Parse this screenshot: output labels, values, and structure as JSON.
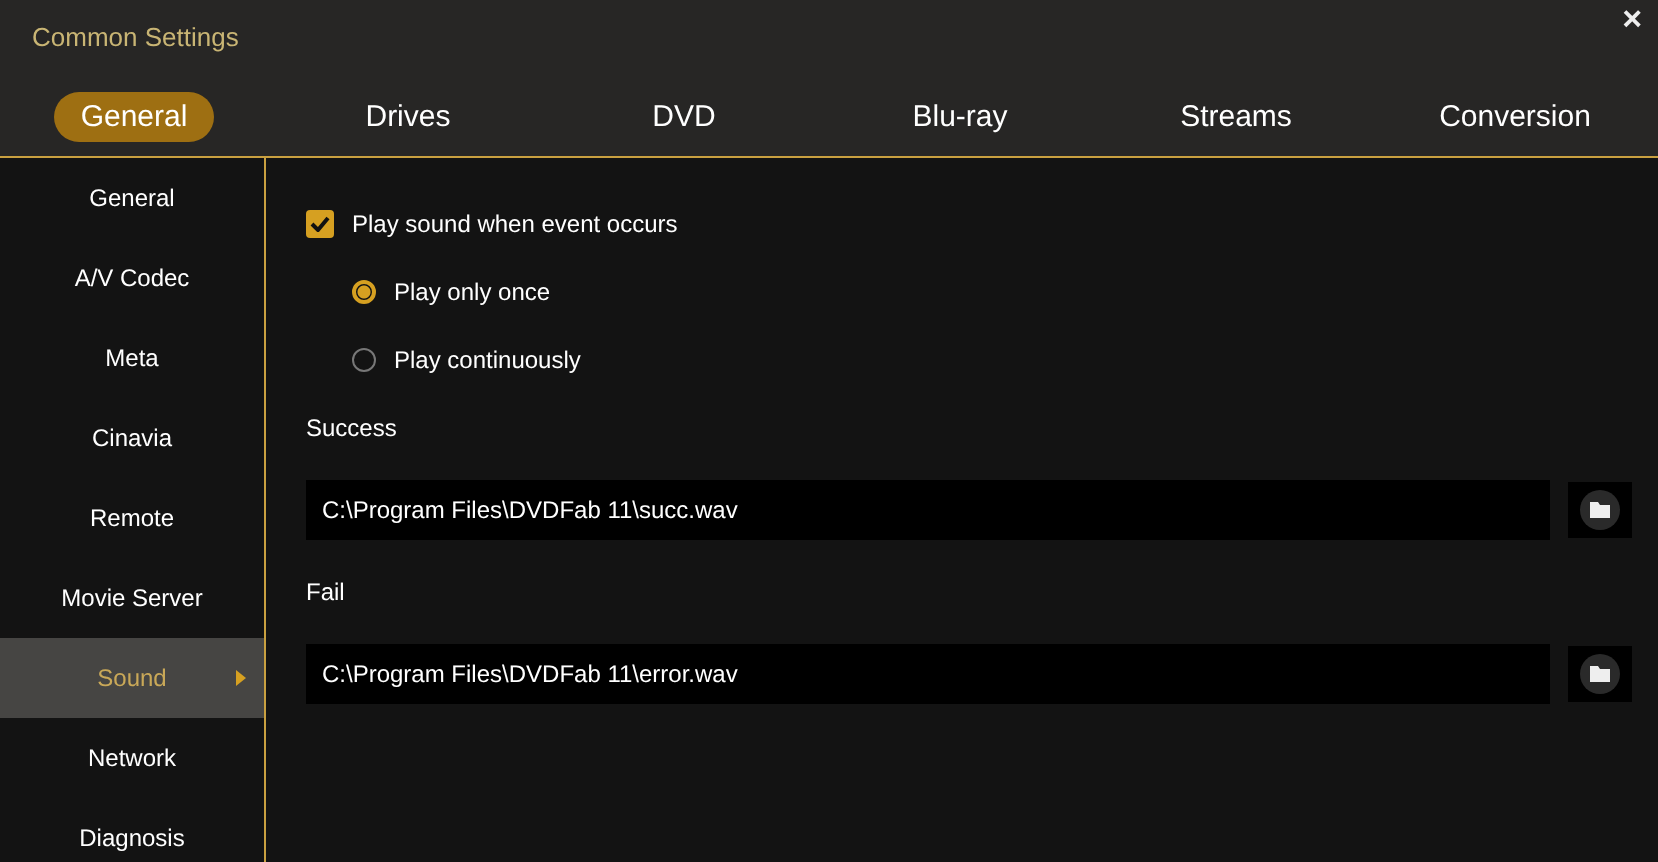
{
  "window": {
    "title": "Common Settings",
    "close": "×"
  },
  "tabs": [
    {
      "label": "General",
      "selected": true
    },
    {
      "label": "Drives",
      "selected": false
    },
    {
      "label": "DVD",
      "selected": false
    },
    {
      "label": "Blu-ray",
      "selected": false
    },
    {
      "label": "Streams",
      "selected": false
    },
    {
      "label": "Conversion",
      "selected": false
    }
  ],
  "sidebar": {
    "items": [
      {
        "label": "General",
        "selected": false
      },
      {
        "label": "A/V Codec",
        "selected": false
      },
      {
        "label": "Meta",
        "selected": false
      },
      {
        "label": "Cinavia",
        "selected": false
      },
      {
        "label": "Remote",
        "selected": false
      },
      {
        "label": "Movie Server",
        "selected": false
      },
      {
        "label": "Sound",
        "selected": true
      },
      {
        "label": "Network",
        "selected": false
      },
      {
        "label": "Diagnosis",
        "selected": false
      }
    ]
  },
  "sound": {
    "play_sound": {
      "label": "Play sound when event occurs",
      "checked": true
    },
    "modes": [
      {
        "label": "Play only once",
        "selected": true
      },
      {
        "label": "Play continuously",
        "selected": false
      }
    ],
    "files": [
      {
        "label": "Success",
        "value": "C:\\Program Files\\DVDFab 11\\succ.wav"
      },
      {
        "label": "Fail",
        "value": "C:\\Program Files\\DVDFab 11\\error.wav"
      }
    ]
  }
}
